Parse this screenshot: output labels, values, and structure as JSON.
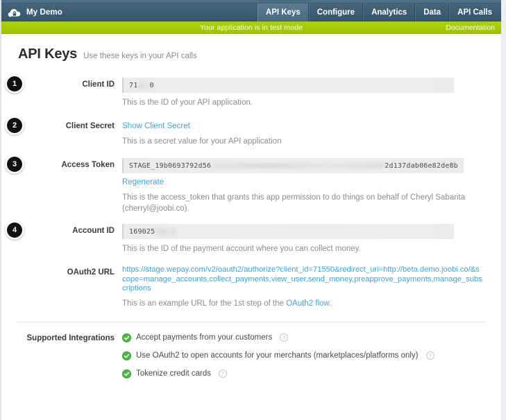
{
  "header": {
    "brand": "My Demo",
    "logo_icon": "cloud-lock-icon",
    "tabs": [
      {
        "label": "API Keys",
        "active": true
      },
      {
        "label": "Configure",
        "active": false
      },
      {
        "label": "Analytics",
        "active": false
      },
      {
        "label": "Data",
        "active": false
      },
      {
        "label": "API Calls",
        "active": false
      }
    ]
  },
  "testbar": {
    "message": "Your application is in test mode",
    "documentation_label": "Documentation",
    "color": "#a5cd07"
  },
  "page": {
    "title": "API Keys",
    "subtitle": "Use these keys in your API calls"
  },
  "fields": {
    "client_id": {
      "badge": "1",
      "label": "Client ID",
      "value_prefix": "71",
      "value_suffix": "0",
      "help": "This is the ID of your API application."
    },
    "client_secret": {
      "badge": "2",
      "label": "Client Secret",
      "show_link": "Show Client Secret",
      "help": "This is a secret value for your API application"
    },
    "access_token": {
      "badge": "3",
      "label": "Access Token",
      "value_prefix": "STAGE_19b0693792d56",
      "value_suffix": "2d137dab06e82de8b",
      "regenerate_link": "Regenerate",
      "help": "This is the access_token that grants this app permission to do things on behalf of Cheryl Sabarita (cherryl@joobi.co)."
    },
    "account_id": {
      "badge": "4",
      "label": "Account ID",
      "value_prefix": "169025",
      "help": "This is the ID of the payment account where you can collect money."
    },
    "oauth2_url": {
      "label": "OAuth2 URL",
      "url": "https://stage.wepay.com/v2/oauth2/authorize?client_id=71550&redirect_uri=http://beta.demo.joobi.co/&scope=manage_accounts,collect_payments,view_user,send_money,preapprove_payments,manage_subscriptions",
      "help_prefix": "This is an example URL for the 1st step of the ",
      "help_link": "OAuth2 flow",
      "help_suffix": "."
    }
  },
  "integrations": {
    "label": "Supported Integrations",
    "items": [
      {
        "text": "Accept payments from your customers",
        "icon": "check-circle-icon",
        "help": "?"
      },
      {
        "text": "Use OAuth2 to open accounts for your merchants (marketplaces/platforms only)",
        "icon": "check-circle-icon",
        "help": "?"
      },
      {
        "text": "Tokenize credit cards",
        "icon": "check-circle-icon",
        "help": "?"
      }
    ]
  },
  "colors": {
    "header_bg": "#3d5c72",
    "testbar_green": "#a5cd07",
    "link_blue": "#3ba3dd",
    "check_green": "#4cb748"
  }
}
